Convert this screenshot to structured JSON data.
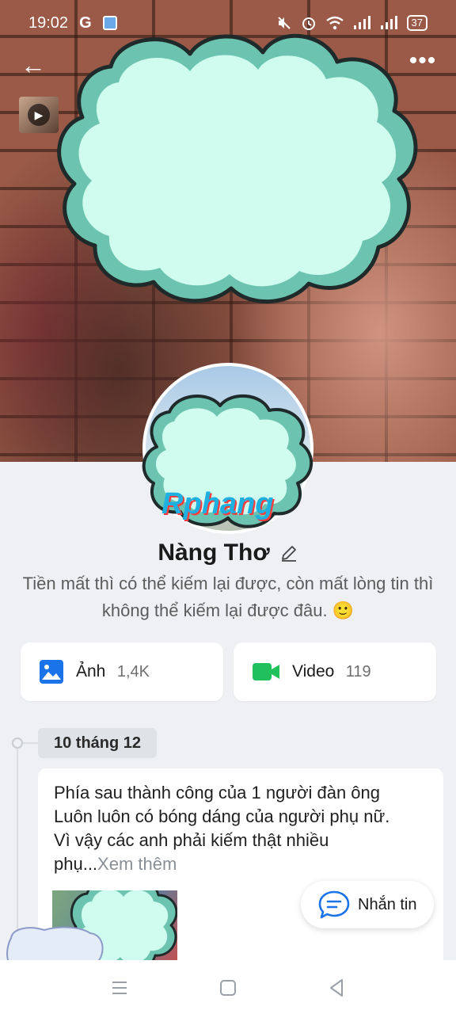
{
  "status_bar": {
    "time": "19:02",
    "carrier_glyph": "G",
    "battery": "37",
    "icons": [
      "mute-icon",
      "alarm-icon",
      "wifi-icon",
      "signal-icon",
      "signal-icon"
    ]
  },
  "nav": {
    "back_icon": "back-arrow-icon",
    "more_icon": "more-icon",
    "more_glyph": "•••",
    "back_glyph": "←"
  },
  "profile": {
    "name": "Nàng Thơ",
    "bio": "Tiền mất thì có thể kiếm lại được, còn mất lòng tin thì không thể kiếm lại được đâu. 🙂",
    "avatar_watermark": "Rphang"
  },
  "media": [
    {
      "label": "Ảnh",
      "count": "1,4K",
      "icon": "photo-icon",
      "color": "#1a73e8"
    },
    {
      "label": "Video",
      "count": "119",
      "icon": "video-icon",
      "color": "#20c05c"
    }
  ],
  "timeline": {
    "date": "10 tháng 12",
    "post": {
      "lines": [
        "Phía sau thành công của 1 người đàn ông",
        "Luôn luôn có bóng dáng của người phụ nữ.",
        "Vì vậy các anh phải kiếm thật nhiều"
      ],
      "last_line_prefix": "phụ...",
      "see_more": "Xem thêm"
    }
  },
  "message_button": {
    "label": "Nhắn tin",
    "icon": "chat-icon"
  },
  "colors": {
    "sticker_fill": "#cffcee",
    "sticker_shadow": "#6cc4b0",
    "sticker_outline": "#1f2a2a"
  }
}
